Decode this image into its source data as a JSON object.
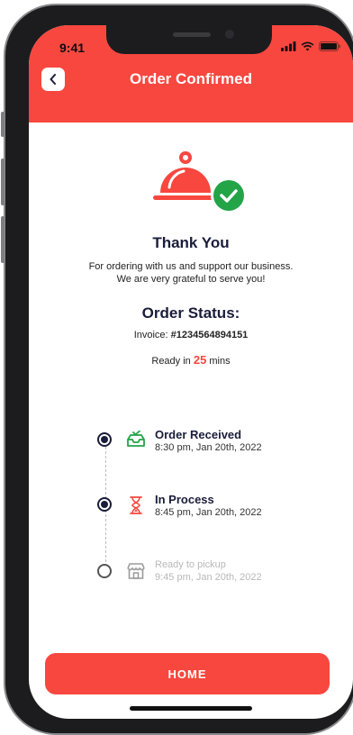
{
  "status_bar": {
    "time": "9:41"
  },
  "header": {
    "title": "Order Confirmed",
    "back_icon": "chevron-left-icon"
  },
  "thank_you": {
    "title": "Thank You",
    "line1": "For ordering with us and support our business.",
    "line2": "We are very grateful to serve you!"
  },
  "order_status": {
    "title": "Order Status:",
    "invoice_label": "Invoice: ",
    "invoice_number": "#1234564894151",
    "ready_prefix": "Ready in ",
    "ready_minutes": "25",
    "ready_suffix": " mins"
  },
  "timeline": [
    {
      "title": "Order Received",
      "time": "8:30 pm, Jan 20th, 2022",
      "state": "done",
      "icon": "inbox-check-icon"
    },
    {
      "title": "In Process",
      "time": "8:45 pm, Jan 20th, 2022",
      "state": "done",
      "icon": "hourglass-icon"
    },
    {
      "title": "Ready to pickup",
      "time": "9:45 pm, Jan 20th, 2022",
      "state": "pending",
      "icon": "store-icon"
    }
  ],
  "home_button": {
    "label": "HOME"
  },
  "colors": {
    "accent": "#f7473f",
    "success": "#22a447",
    "text_dark": "#1a1d3a"
  }
}
